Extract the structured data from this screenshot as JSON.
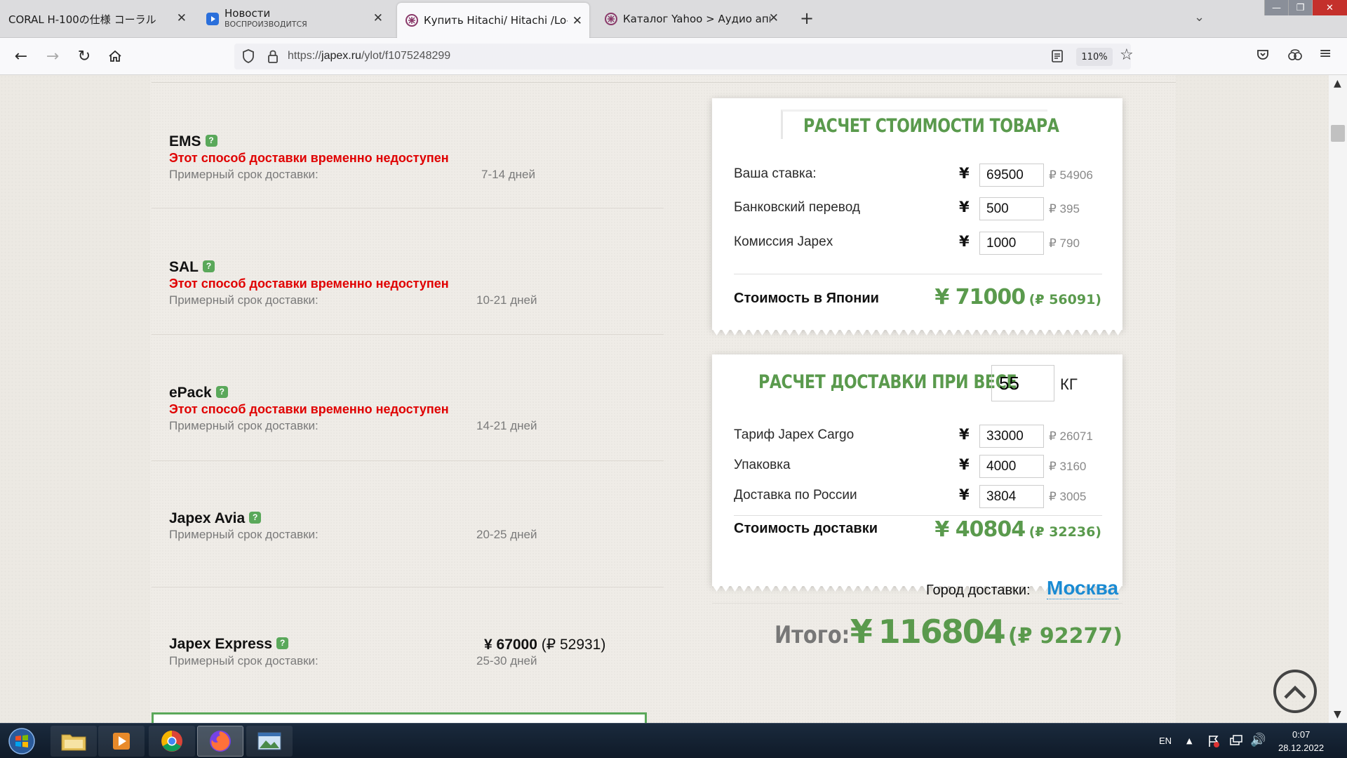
{
  "browser": {
    "tabs": [
      {
        "title": "CORAL H-100の仕様 コーラル",
        "subtitle": "",
        "active": false
      },
      {
        "title": "Новости",
        "subtitle": "ВОСПРОИЗВОДИТСЯ",
        "active": false
      },
      {
        "title": "Купить Hitachi/ Hitachi /Lo-D H",
        "subtitle": "",
        "active": true
      },
      {
        "title": "Каталог Yahoo > Аудио аппар",
        "subtitle": "",
        "active": false
      }
    ],
    "url_prefix": "https://",
    "url_host": "japex.ru",
    "url_path": "/ylot/f1075248299",
    "zoom": "110%"
  },
  "shipping_methods": [
    {
      "name": "EMS",
      "unavailable": "Этот способ доставки временно недоступен",
      "est_label": "Примерный срок доставки:",
      "days": "7-14 дней"
    },
    {
      "name": "SAL",
      "unavailable": "Этот способ доставки временно недоступен",
      "est_label": "Примерный срок доставки:",
      "days": "10-21 дней"
    },
    {
      "name": "ePack",
      "unavailable": "Этот способ доставки временно недоступен",
      "est_label": "Примерный срок доставки:",
      "days": "14-21 дней"
    },
    {
      "name": "Japex Avia",
      "unavailable": "",
      "est_label": "Примерный срок доставки:",
      "days": "20-25 дней"
    },
    {
      "name": "Japex Express",
      "unavailable": "",
      "est_label": "Примерный срок доставки:",
      "days": "25-30 дней",
      "price_yen": "¥ 67000",
      "price_rub": "(₽ 52931)"
    }
  ],
  "cost_card": {
    "title": "РАСЧЕТ СТОИМОСТИ ТОВАРА",
    "rows": [
      {
        "label": "Ваша ставка:",
        "yen": "69500",
        "rub": "₽ 54906"
      },
      {
        "label": "Банковский перевод",
        "yen": "500",
        "rub": "₽ 395"
      },
      {
        "label": "Комиссия Japex",
        "yen": "1000",
        "rub": "₽ 790"
      }
    ],
    "total_label": "Стоимость в Японии",
    "total_yen": "¥ 71000",
    "total_rub": "(₽ 56091)"
  },
  "delivery_card": {
    "title": "РАСЧЕТ ДОСТАВКИ ПРИ ВЕСЕ",
    "weight": "55",
    "unit": "КГ",
    "rows": [
      {
        "label": "Тариф Japex Cargo",
        "yen": "33000",
        "rub": "₽ 26071"
      },
      {
        "label": "Упаковка",
        "yen": "4000",
        "rub": "₽ 3160"
      },
      {
        "label": "Доставка по России",
        "yen": "3804",
        "rub": "₽ 3005"
      }
    ],
    "total_label": "Стоимость доставки",
    "total_yen": "¥ 40804",
    "total_rub": "(₽ 32236)"
  },
  "city": {
    "label": "Город доставки:",
    "value": "Москва"
  },
  "grand_total": {
    "label": "Итого:",
    "yen_symbol": "¥",
    "yen": "116804",
    "rub": "(₽ 92277)"
  },
  "yen_symbol": "¥",
  "help_mark": "?",
  "taskbar": {
    "lang": "EN",
    "time": "0:07",
    "date": "28.12.2022"
  },
  "colors": {
    "green": "#5a9a4d",
    "red": "#e00000",
    "link": "#1a8bd3"
  }
}
